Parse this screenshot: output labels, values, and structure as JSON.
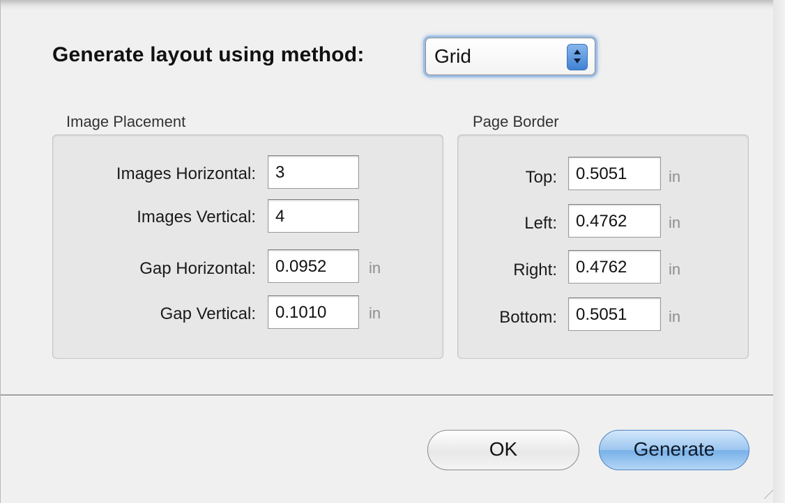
{
  "dialog": {
    "method_label": "Generate layout using method:",
    "method_value": "Grid"
  },
  "image_placement": {
    "title": "Image Placement",
    "fields": [
      {
        "label": "Images Horizontal:",
        "value": "3",
        "unit": ""
      },
      {
        "label": "Images Vertical:",
        "value": "4",
        "unit": ""
      },
      {
        "label": "Gap Horizontal:",
        "value": "0.0952",
        "unit": "in"
      },
      {
        "label": "Gap Vertical:",
        "value": "0.1010",
        "unit": "in"
      }
    ]
  },
  "page_border": {
    "title": "Page Border",
    "fields": [
      {
        "label": "Top:",
        "value": "0.5051",
        "unit": "in"
      },
      {
        "label": "Left:",
        "value": "0.4762",
        "unit": "in"
      },
      {
        "label": "Right:",
        "value": "0.4762",
        "unit": "in"
      },
      {
        "label": "Bottom:",
        "value": "0.5051",
        "unit": "in"
      }
    ]
  },
  "buttons": {
    "ok": "OK",
    "generate": "Generate"
  },
  "colors": {
    "focus_ring": "#9cc0e6",
    "default_button": "#78b0e9",
    "unit_text": "#8e8e8e"
  }
}
